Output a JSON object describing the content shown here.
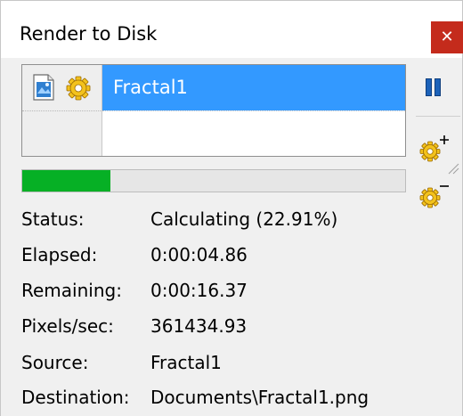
{
  "window": {
    "title": "Render to Disk",
    "close_label": "✕"
  },
  "render_list": {
    "items": [
      {
        "label": "Fractal1",
        "selected": true
      }
    ]
  },
  "progress": {
    "fraction": 0.2291,
    "color": "#06b025"
  },
  "info": {
    "status_label": "Status:",
    "status_value": "Calculating (22.91%)",
    "elapsed_label": "Elapsed:",
    "elapsed_value": "0:00:04.86",
    "remaining_label": "Remaining:",
    "remaining_value": "0:00:16.37",
    "pixels_label": "Pixels/sec:",
    "pixels_value": "361434.93",
    "source_label": "Source:",
    "source_value": "Fractal1",
    "destination_label": "Destination:",
    "destination_value": "Documents\\Fractal1.png"
  },
  "colors": {
    "selection": "#3399ff",
    "close": "#c42b1c",
    "pause": "#1c62b9"
  },
  "icons": [
    "image-icon",
    "gear-icon",
    "pause-icon",
    "add-gear-icon",
    "remove-gear-icon",
    "resize-grip-icon"
  ]
}
